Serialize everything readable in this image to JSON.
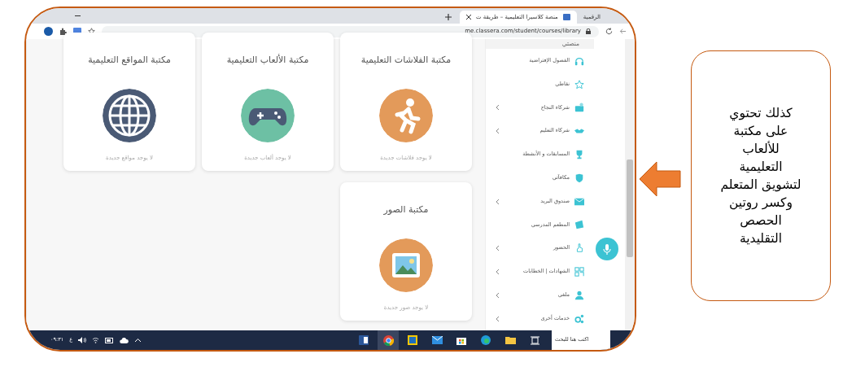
{
  "browser": {
    "tabs": [
      {
        "title": "الرقمية",
        "selected": false
      },
      {
        "title": "منصة كلاسيرا التعليمية – طريقة ت",
        "selected": true
      }
    ],
    "url": "me.classera.com/student/courses/library"
  },
  "libraries": [
    {
      "title": "مكتبة الفلاشات التعليمية",
      "empty_text": "لا يوجد فلاشات جديدة",
      "color": "#e39a5a"
    },
    {
      "title": "مكتبة الألعاب التعليمية",
      "empty_text": "لا يوجد ألعاب جديدة",
      "color": "#6dc0a4"
    },
    {
      "title": "مكتبة المواقع التعليمية",
      "empty_text": "لا يوجد مواقع جديدة",
      "color": "#4a5a75"
    },
    {
      "title": "مكتبة الصور",
      "empty_text": "لا يوجد صور جديدة",
      "color": "#e39a5a"
    }
  ],
  "sidebar": {
    "header": "منصتي",
    "items": [
      {
        "label": "الفصول الإفتراضية",
        "has_submenu": false
      },
      {
        "label": "نقاطي",
        "has_submenu": false
      },
      {
        "label": "شركاء النجاح",
        "has_submenu": true
      },
      {
        "label": "شركاء التعليم",
        "has_submenu": true
      },
      {
        "label": "المسابقات و الأنشطة",
        "has_submenu": false
      },
      {
        "label": "مكافآتي",
        "has_submenu": false
      },
      {
        "label": "صندوق البريد",
        "has_submenu": true
      },
      {
        "label": "المطعم المدرسي",
        "has_submenu": false
      },
      {
        "label": "الحضور",
        "has_submenu": true
      },
      {
        "label": "الشهادات | الخطابات",
        "has_submenu": true
      },
      {
        "label": "ملفي",
        "has_submenu": true
      },
      {
        "label": "خدمات أخرى",
        "has_submenu": true
      }
    ]
  },
  "taskbar": {
    "search_placeholder": "اكتب هنا للبحث",
    "clock": "٠٩:٣١",
    "language": "ع"
  },
  "callout": {
    "text": "كذلك تحتوي\nعلى مكتبة\nللألعاب\nالتعليمية\nلتشويق المتعلم\nوكسر روتين\nالحصص\nالتقليدية"
  }
}
